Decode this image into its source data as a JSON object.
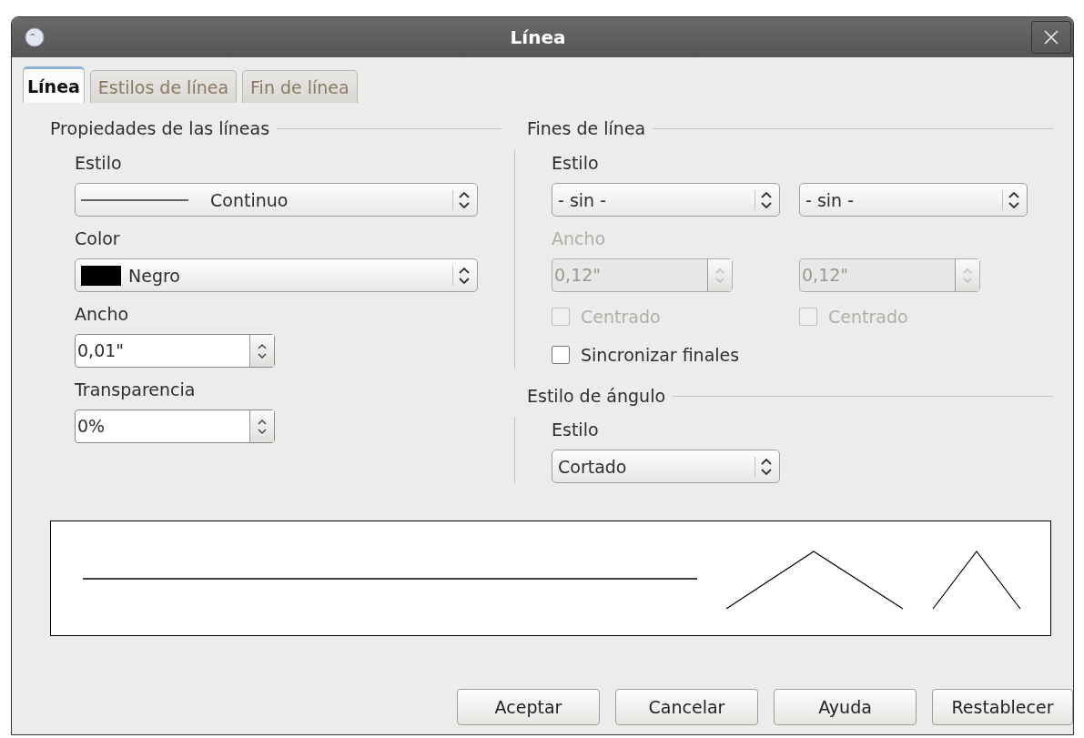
{
  "window": {
    "title": "Línea"
  },
  "tabs": [
    {
      "label": "Línea",
      "selected": true
    },
    {
      "label": "Estilos de línea",
      "selected": false
    },
    {
      "label": "Fin de línea",
      "selected": false
    }
  ],
  "line_properties": {
    "heading": "Propiedades de las líneas",
    "style": {
      "label": "Estilo",
      "value": "Continuo"
    },
    "color": {
      "label": "Color",
      "value": "Negro",
      "color": "#000000"
    },
    "width": {
      "label": "Ancho",
      "value": "0,01\""
    },
    "transparency": {
      "label": "Transparencia",
      "value": "0%"
    }
  },
  "line_ends": {
    "heading": "Fines de línea",
    "style_label": "Estilo",
    "width_label": "Ancho",
    "width_disabled": true,
    "ends": [
      {
        "style": "- sin -",
        "width": "0,12\"",
        "centered_label": "Centrado",
        "centered": false,
        "disabled": true
      },
      {
        "style": "- sin -",
        "width": "0,12\"",
        "centered_label": "Centrado",
        "centered": false,
        "disabled": true
      }
    ],
    "sync": {
      "label": "Sincronizar finales",
      "checked": false
    }
  },
  "corner_style": {
    "heading": "Estilo de ángulo",
    "label": "Estilo",
    "value": "Cortado"
  },
  "buttons": [
    {
      "label": "Aceptar"
    },
    {
      "label": "Cancelar"
    },
    {
      "label": "Ayuda"
    },
    {
      "label": "Restablecer"
    }
  ]
}
